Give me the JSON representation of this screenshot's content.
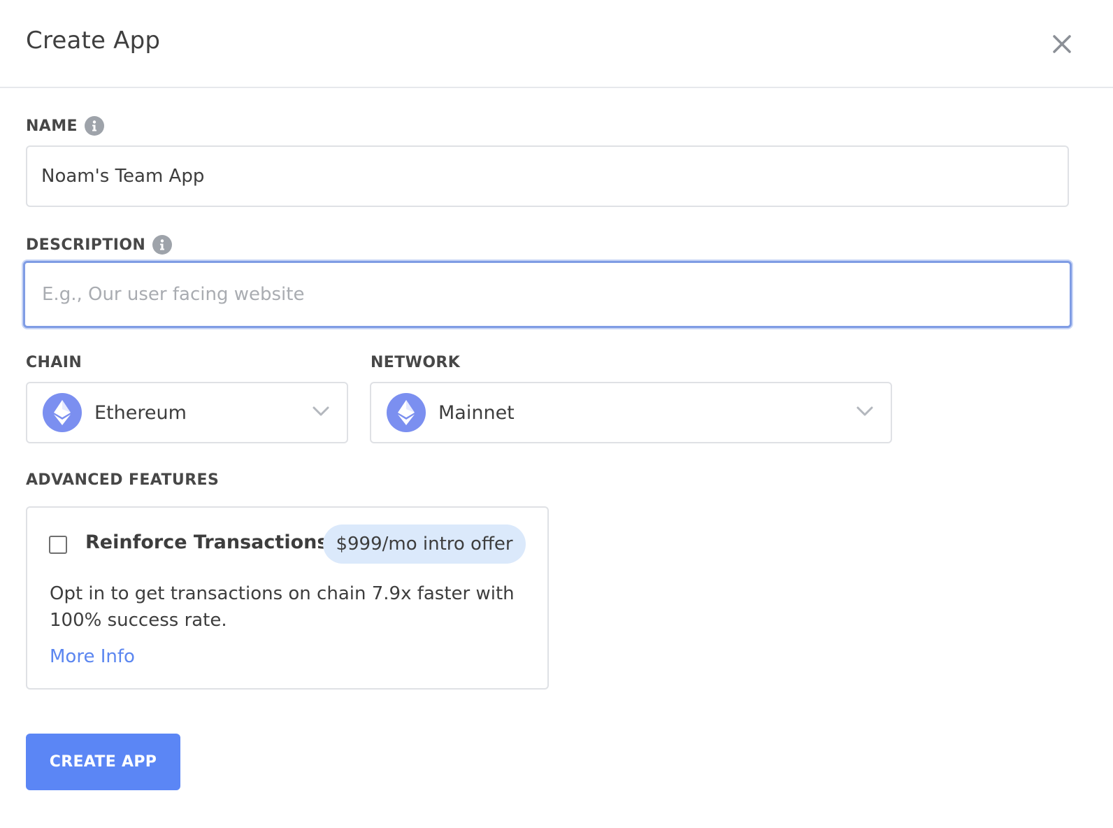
{
  "modal": {
    "title": "Create App",
    "close_icon": "close-icon"
  },
  "name_field": {
    "label": "NAME",
    "value": "Noam's Team App",
    "info_icon": "info-icon"
  },
  "description_field": {
    "label": "DESCRIPTION",
    "value": "",
    "placeholder": "E.g., Our user facing website",
    "info_icon": "info-icon"
  },
  "chain": {
    "label": "CHAIN",
    "selected": "Ethereum",
    "icon": "ethereum-icon"
  },
  "network": {
    "label": "NETWORK",
    "selected": "Mainnet",
    "icon": "ethereum-icon"
  },
  "advanced": {
    "label": "ADVANCED FEATURES",
    "feature": {
      "checked": false,
      "title": "Reinforce Transactions",
      "badge": "$999/mo intro offer",
      "description": "Opt in to get transactions on chain 7.9x faster with 100% success rate.",
      "link": "More Info"
    }
  },
  "actions": {
    "create_label": "CREATE APP"
  },
  "colors": {
    "primary": "#5b86f5",
    "link": "#5b86f0",
    "badge_bg": "#dbe9fb",
    "focus_ring": "#7f9ce4",
    "eth_badge": "#7b8ff0"
  }
}
